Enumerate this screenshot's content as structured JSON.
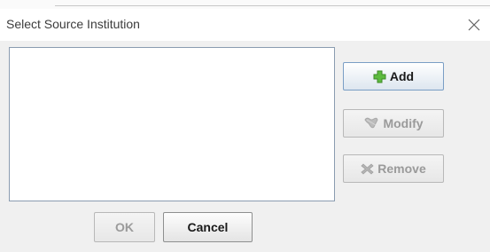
{
  "dialog": {
    "title": "Select Source Institution",
    "close_icon": "close-icon"
  },
  "source_list": {
    "items": []
  },
  "side_buttons": {
    "add_label": "Add",
    "add_icon": "plus-icon",
    "modify_label": "Modify",
    "modify_icon": "edit-icon",
    "remove_label": "Remove",
    "remove_icon": "delete-x-icon"
  },
  "footer": {
    "ok_label": "OK",
    "cancel_label": "Cancel"
  },
  "colors": {
    "add_icon_green": "#5dbb3f",
    "disabled_text": "#9a9a9a",
    "list_border": "#8a9cb0"
  }
}
